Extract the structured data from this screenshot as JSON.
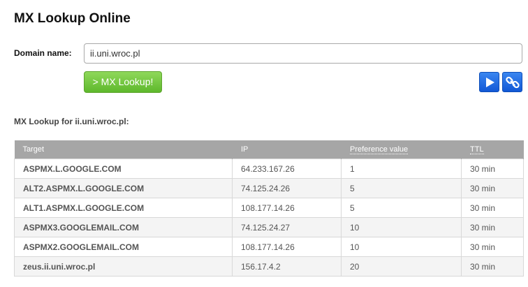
{
  "header": {
    "title": "MX Lookup Online"
  },
  "form": {
    "domain_label": "Domain name:",
    "domain_value": "ii.uni.wroc.pl",
    "lookup_button_label": "> MX Lookup!"
  },
  "results": {
    "heading": "MX Lookup for ii.uni.wroc.pl:",
    "columns": [
      "Target",
      "IP",
      "Preference value",
      "TTL"
    ],
    "rows": [
      {
        "target": "ASPMX.L.GOOGLE.COM",
        "ip": "64.233.167.26",
        "preference": "1",
        "ttl": "30 min"
      },
      {
        "target": "ALT2.ASPMX.L.GOOGLE.COM",
        "ip": "74.125.24.26",
        "preference": "5",
        "ttl": "30 min"
      },
      {
        "target": "ALT1.ASPMX.L.GOOGLE.COM",
        "ip": "108.177.14.26",
        "preference": "5",
        "ttl": "30 min"
      },
      {
        "target": "ASPMX3.GOOGLEMAIL.COM",
        "ip": "74.125.24.27",
        "preference": "10",
        "ttl": "30 min"
      },
      {
        "target": "ASPMX2.GOOGLEMAIL.COM",
        "ip": "108.177.14.26",
        "preference": "10",
        "ttl": "30 min"
      },
      {
        "target": "zeus.ii.uni.wroc.pl",
        "ip": "156.17.4.2",
        "preference": "20",
        "ttl": "30 min"
      }
    ]
  },
  "icons": {
    "play": "play-icon",
    "link": "link-icon"
  },
  "colors": {
    "lookup_button": "#5eb82c",
    "icon_button": "#1258d6",
    "table_header": "#a6a6a6"
  }
}
